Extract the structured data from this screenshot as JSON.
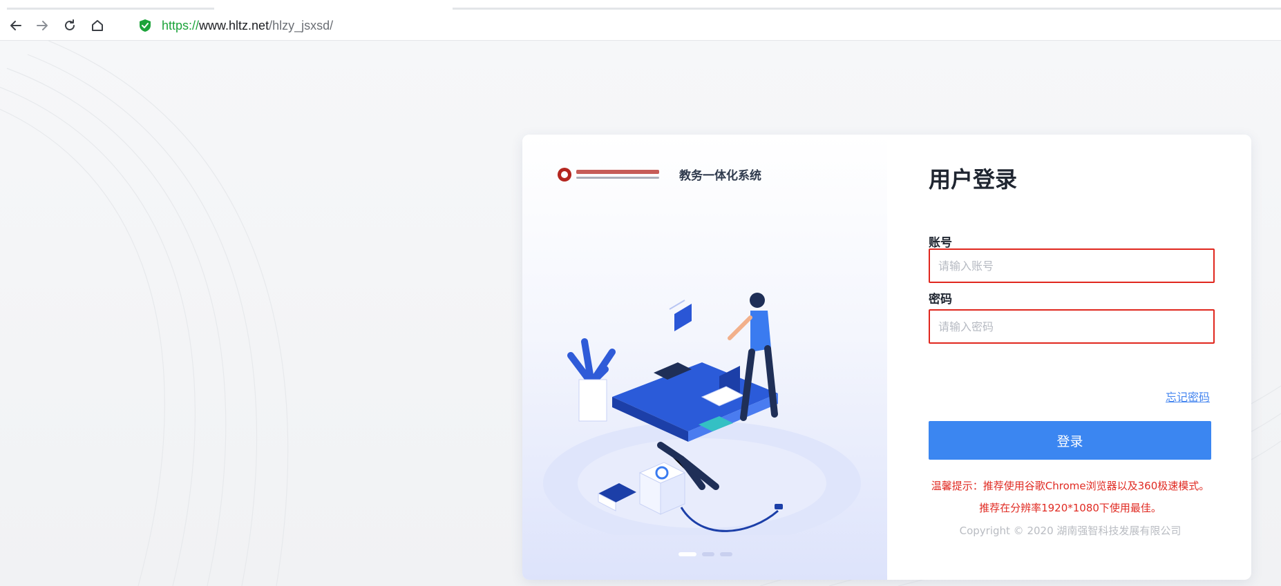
{
  "browser": {
    "url_scheme": "https://",
    "url_host": "www.hltz.net",
    "url_path": "/hlzy_jsxsd/",
    "icons": [
      "back-icon",
      "forward-icon",
      "reload-icon",
      "home-icon",
      "shield-icon"
    ]
  },
  "brand": {
    "system_name": "教务一体化系统"
  },
  "login": {
    "title": "用户登录",
    "account_label": "账号",
    "account_placeholder": "请输入账号",
    "password_label": "密码",
    "password_placeholder": "请输入密码",
    "forgot_password": "忘记密码",
    "submit_label": "登录",
    "tip_line1": "温馨提示：推荐使用谷歌Chrome浏览器以及360极速模式。",
    "tip_line2": "推荐在分辨率1920*1080下使用最佳。",
    "copyright": "Copyright © 2020 湖南强智科技发展有限公司"
  },
  "colors": {
    "primary": "#3b86f1",
    "highlight_border": "#e0261d",
    "tip": "#e02a22",
    "secure": "#1ca33a"
  }
}
